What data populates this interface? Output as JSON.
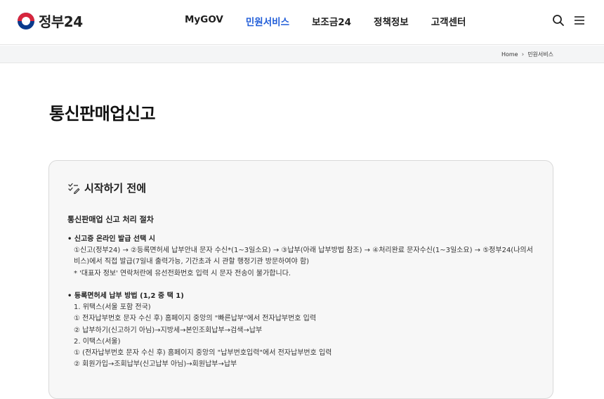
{
  "header": {
    "logo_text": "정부24",
    "nav": [
      "MyGOV",
      "민원서비스",
      "보조금24",
      "정책정보",
      "고객센터"
    ],
    "active_nav_index": 1,
    "icons": [
      "search-icon",
      "menu-icon"
    ]
  },
  "breadcrumb": {
    "home": "Home",
    "current": "민원서비스"
  },
  "page_title": "통신판매업신고",
  "card": {
    "title": "시작하기 전에",
    "section_title": "통신판매업 신고 처리 절차",
    "block1": {
      "heading": "• 신고증 온라인 발급 선택 시",
      "line1": "①신고(정부24) → ②등록면허세 납부안내 문자 수신*(1~3일소요) → ③납부(아래 납부방법 참조) → ④처리완료 문자수신(1~3일소요) → ⑤정부24(나의서",
      "line2": "비스)에서 직접 발급(7일내 출력가능, 기간초과 시 관할 행정기관 방문하여야 함)",
      "line3": "* '대표자 정보' 연락처란에 유선전화번호 입력 시 문자 전송이 불가합니다."
    },
    "block2": {
      "heading": "• 등록면허세 납부 방법 (1,2 중 택 1)",
      "lines": [
        "1. 위택스(서울 포함 전국)",
        "① 전자납부번호 문자 수신 후) 홈페이지 중앙의 \"빠른납부\"에서 전자납부번호 입력",
        "② 납부하기(신고하기 아님)→지방세→본인조회납부→검색→납부",
        "2. 이택스(서울)",
        "① (전자납부번호 문자 수신 후) 홈페이지 중앙의 \"납부번호입력\"에서 전자납부번호 입력",
        "② 회원가입→조회납부(신고납부 아님)→회원납부→납부"
      ]
    }
  }
}
